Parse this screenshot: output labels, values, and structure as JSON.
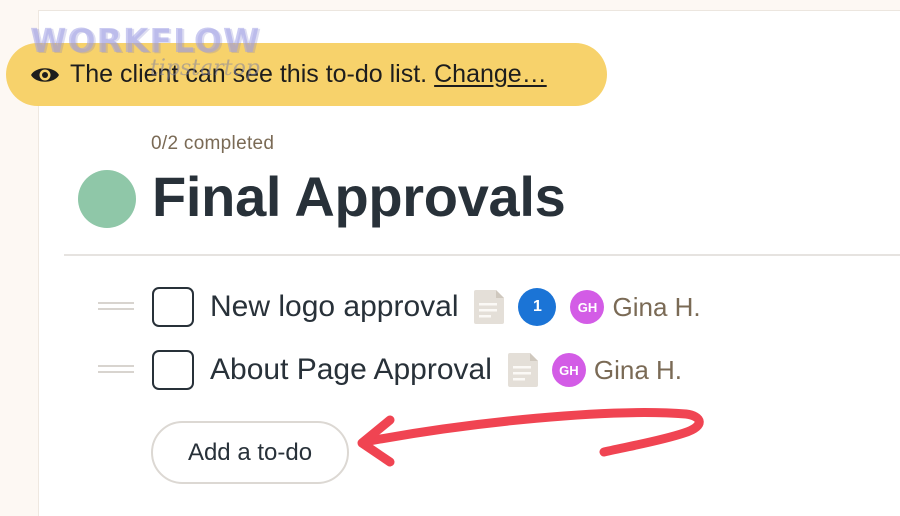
{
  "watermark": {
    "main": "WORKFLOW",
    "sub": "tipstartop"
  },
  "banner": {
    "text": "The client can see this to-do list.",
    "link_label": "Change…",
    "background": "#f7d26b",
    "icon": "eye-icon"
  },
  "list": {
    "progress": "0/2 completed",
    "title": "Final Approvals",
    "dot_color": "#8fc7a8"
  },
  "todos": [
    {
      "label": "New logo approval",
      "completed": false,
      "has_notes": true,
      "comment_count": "1",
      "assignee_initials": "GH",
      "assignee_name": "Gina H."
    },
    {
      "label": "About Page Approval",
      "completed": false,
      "has_notes": true,
      "assignee_initials": "GH",
      "assignee_name": "Gina H."
    }
  ],
  "add_todo": {
    "label": "Add a to-do"
  },
  "colors": {
    "comment_badge": "#1b74d6",
    "avatar": "#d35ce6",
    "arrow": "#f04452"
  }
}
